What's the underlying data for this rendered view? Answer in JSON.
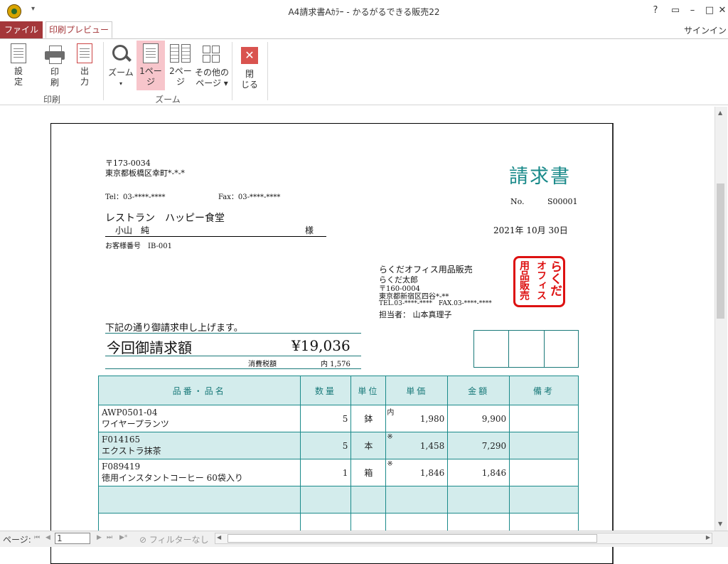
{
  "window": {
    "title": "A4請求書Aｶﾗｰ - かるがるできる販売22",
    "help": "?",
    "restore": "▭",
    "minimize": "–",
    "maximize": "□",
    "close": "✕",
    "qat": "▾"
  },
  "ribbon": {
    "tabs": {
      "file": "ファイル",
      "preview": "印刷プレビュー"
    },
    "signin": "サインイン",
    "groups": {
      "print": {
        "label": "印刷",
        "settings": "設\n定",
        "print": "印\n刷",
        "output": "出\n力",
        "settings_l1": "設",
        "settings_l2": "定",
        "print_l1": "印",
        "print_l2": "刷",
        "output_l1": "出",
        "output_l2": "力"
      },
      "zoom": {
        "label": "ズーム",
        "zoom_l1": "ズーム",
        "zoom_l2": "▾",
        "one_l1": "1ペー",
        "one_l2": "ジ",
        "two_l1": "2ペー",
        "two_l2": "ジ",
        "other_l1": "その他の",
        "other_l2": "ページ ▾"
      },
      "close": {
        "l1": "閉",
        "l2": "じる"
      }
    }
  },
  "invoice": {
    "sender_postal": "〒173-0034",
    "sender_address": "東京都板橋区幸町*-*-*",
    "tel": "Tel：03-****-****",
    "fax": "Fax：03-****-****",
    "title": "請求書",
    "no_label": "No.",
    "no_value": "S00001",
    "customer_company": "レストラン　ハッピー食堂",
    "customer_person": "小山　純",
    "honorific": "様",
    "date": "2021年 10月 30日",
    "customer_no": "お客様番号　IB-001",
    "issuer_company": "らくだオフィス用品販売",
    "issuer_person": "らくだ太郎",
    "issuer_postal": "〒160-0004",
    "issuer_address": "東京都新宿区四谷*-**",
    "issuer_telfax": "TEL.03-****-****　FAX.03-****-****",
    "staff": "担当者：  山本真理子",
    "stamp_col1": "らくだ",
    "stamp_col2": "オフィス",
    "stamp_col3": "用品販売",
    "intro": "下記の通り御請求申し上げます。",
    "amount_label": "今回御請求額",
    "amount_value": "¥19,036",
    "tax_label": "消費税額",
    "tax_value": "内 1,576",
    "columns": [
      "品番・品名",
      "数量",
      "単位",
      "単価",
      "金額",
      "備考"
    ],
    "rows": [
      {
        "code": "AWP0501-04",
        "name": "ワイヤープランツ",
        "qty": "5",
        "unit": "鉢",
        "mark": "内",
        "price": "1,980",
        "amount": "9,900",
        "note": ""
      },
      {
        "code": "F014165",
        "name": "エクストラ抹茶",
        "qty": "5",
        "unit": "本",
        "mark": "※",
        "price": "1,458",
        "amount": "7,290",
        "note": ""
      },
      {
        "code": "F089419",
        "name": "徳用インスタントコーヒー 60袋入り",
        "qty": "1",
        "unit": "箱",
        "mark": "※",
        "price": "1,846",
        "amount": "1,846",
        "note": ""
      }
    ]
  },
  "statusbar": {
    "page_label": "ページ:",
    "page_value": "1",
    "filter": "フィルターなし",
    "first": "⏮",
    "prev": "◀",
    "next": "▶",
    "last": "⏭",
    "new": "▶*"
  }
}
